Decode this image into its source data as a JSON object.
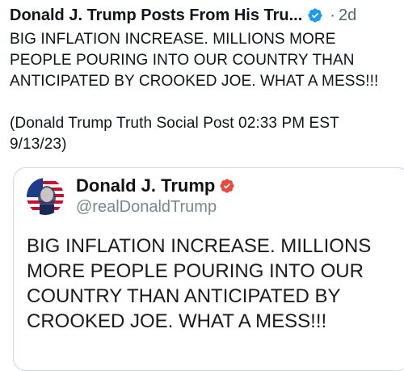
{
  "post": {
    "author": "Donald J. Trump Posts From His Tru...",
    "separator": "·",
    "time": "2d",
    "text": "BIG INFLATION INCREASE. MILLIONS MORE\nPEOPLE POURING INTO OUR COUNTRY THAN\nANTICIPATED BY CROOKED JOE. WHAT A MESS!!!\n\n(Donald Trump Truth Social Post 02:33 PM EST\n9/13/23)"
  },
  "quoted": {
    "name": "Donald J. Trump",
    "handle": "@realDonaldTrump",
    "text": "BIG INFLATION INCREASE. MILLIONS\nMORE PEOPLE POURING INTO OUR\nCOUNTRY THAN ANTICIPATED BY\nCROOKED JOE. WHAT A MESS!!!"
  },
  "colors": {
    "verified_blue": "#1d9bf0",
    "truth_badge_red": "#e8493f"
  },
  "icons": {
    "verified": "verified-badge-icon",
    "truth_verified": "truth-verified-badge-icon"
  }
}
